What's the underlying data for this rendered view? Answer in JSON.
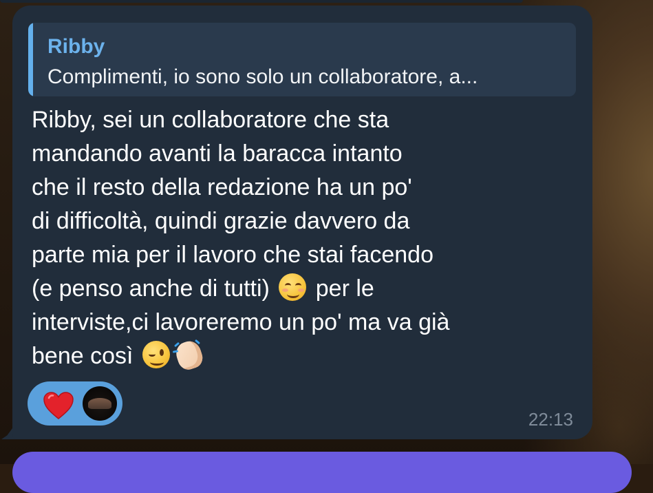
{
  "message": {
    "reply": {
      "author": "Ribby",
      "snippet": "Complimenti, io sono solo un collaboratore, a..."
    },
    "lines": [
      "Ribby, sei un collaboratore che sta",
      "mandando avanti la baracca intanto",
      "che il resto della redazione ha un po'",
      "di difficoltà, quindi grazie davvero da",
      "parte mia per il lavoro che stai facendo"
    ],
    "line6_before": "(e penso anche di tutti) ",
    "line6_after": " per le",
    "line7": "interviste,ci lavoreremo un po' ma va già",
    "line8": "bene così ",
    "emojis": [
      "smiling-face-with-smiling-eyes",
      "winking-face",
      "clapping-hands"
    ],
    "reactions": [
      {
        "emoji": "red-heart",
        "reactor": "avatar"
      }
    ],
    "time": "22:13"
  },
  "colors": {
    "bubble": "#212d3b",
    "reply_accent": "#64b0ec",
    "reaction_pill": "#5aa0dc",
    "next_bubble": "#6a5be0"
  }
}
